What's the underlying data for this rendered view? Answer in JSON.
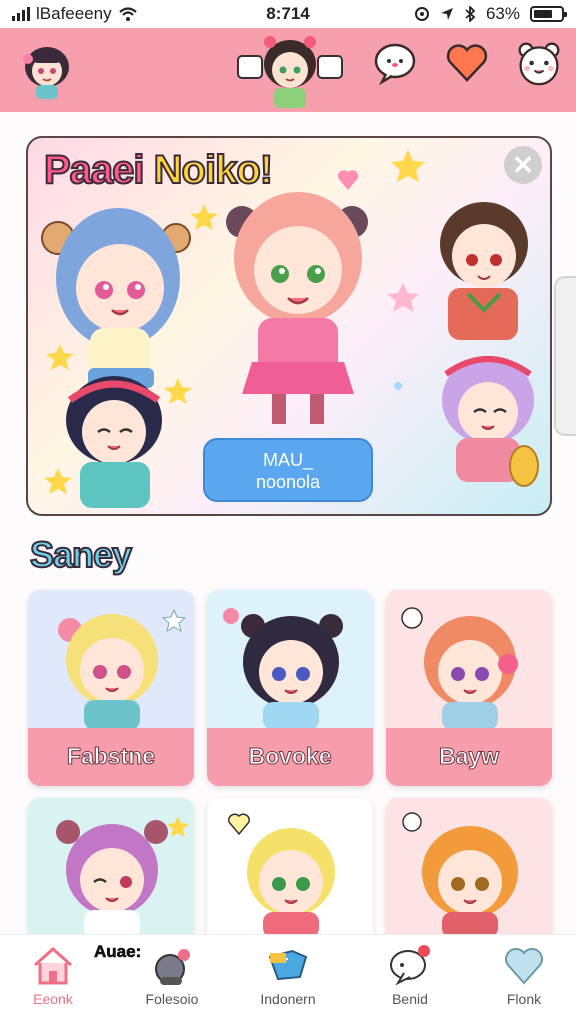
{
  "status_bar": {
    "carrier": "lBafeeeny",
    "time": "8:714",
    "battery": "63%"
  },
  "header": {
    "icons": [
      "avatar",
      "chat-bubble-icon",
      "heart-icon",
      "bear-icon"
    ]
  },
  "banner": {
    "title_part1": "Paaei",
    "title_part2": "Noiko!",
    "close_label": "✕",
    "cta_line1": "MAU_",
    "cta_line2": "noonola"
  },
  "section": {
    "title": "Saney"
  },
  "cards": [
    {
      "label": "Fabstne"
    },
    {
      "label": "Bovoke"
    },
    {
      "label": "Bayw"
    },
    {
      "label": ""
    },
    {
      "label": ""
    },
    {
      "label": ""
    }
  ],
  "bottom_nav": {
    "overlay_text": "Auae:",
    "items": [
      {
        "label": "Eeonk"
      },
      {
        "label": "Folesoio"
      },
      {
        "label": "Indonern"
      },
      {
        "label": "Benid"
      },
      {
        "label": "Flonk"
      }
    ]
  },
  "colors": {
    "header": "#f7a0ad",
    "card_label": "#f79cab",
    "cta": "#5aa7ef",
    "nav_active": "#ef6f86"
  }
}
